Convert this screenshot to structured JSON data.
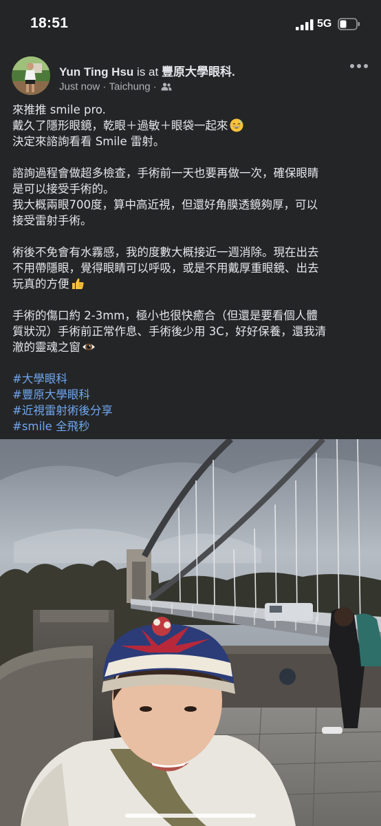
{
  "status_bar": {
    "time": "18:51",
    "network": "5G"
  },
  "post": {
    "author": "Yun Ting Hsu",
    "is_at": "is at",
    "location": "豐原大學眼科.",
    "timestamp": "Just now",
    "place": "Taichung",
    "separator": "·",
    "audience_icon": "friends-icon",
    "more_icon": "more-horizontal-icon",
    "body": {
      "p1_l1": "來推推 smile pro.",
      "p1_l2": "戴久了隱形眼鏡，乾眼＋過敏＋眼袋一起來",
      "p1_l2_emoji": "sweat-smile-emoji",
      "p1_l3": "決定來諮詢看看 Smile 雷射。",
      "p2_l1": "諮詢過程會做超多檢查，手術前一天也要再做一次，確保眼睛",
      "p2_l2": "是可以接受手術的。",
      "p2_l3": "我大概兩眼700度，算中高近視，但還好角膜透鏡夠厚，可以",
      "p2_l4": "接受雷射手術。",
      "p3_l1": "術後不免會有水霧感，我的度數大概接近一週消除。現在出去",
      "p3_l2": "不用帶隱眼，覺得眼睛可以呼吸，或是不用戴厚重眼鏡、出去",
      "p3_l3": "玩真的方便",
      "p3_l3_emoji": "thumbs-up-emoji",
      "p4_l1": "手術的傷口約 2-3mm，極小也很快癒合（但還是要看個人體",
      "p4_l2": "質狀況）手術前正常作息、手術後少用 3C，好好保養，還我清",
      "p4_l3": "澈的靈魂之窗",
      "p4_l3_emoji": "eye-emoji"
    },
    "hashtags": [
      "#大學眼科",
      "#豐原大學眼科",
      "#近視雷射術後分享",
      "#smile 全飛秒"
    ]
  },
  "photo": {
    "subject": "selfie-at-suspension-bridge"
  },
  "colors": {
    "background": "#242526",
    "text": "#e4e6eb",
    "muted": "#b0b3b8",
    "hashtag": "#6fa7f2"
  }
}
